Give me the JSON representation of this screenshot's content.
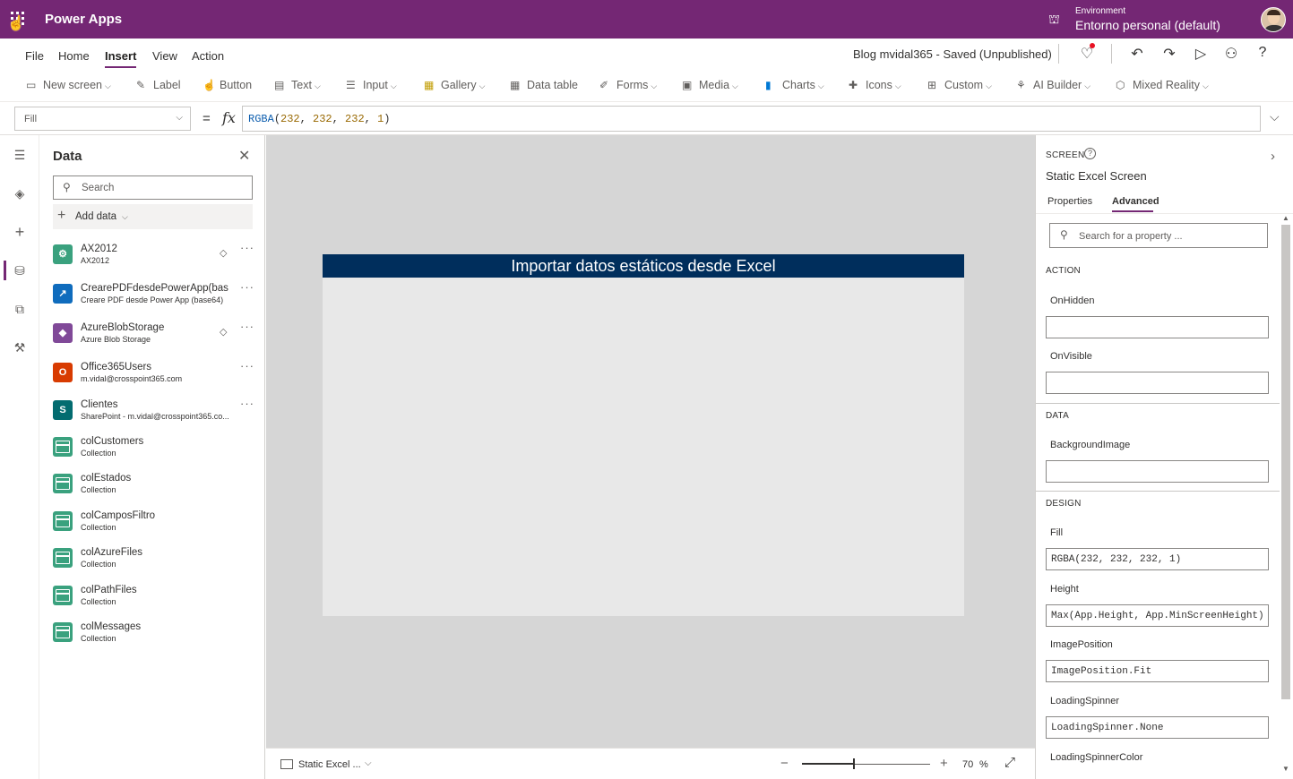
{
  "app": {
    "title": "Power Apps",
    "environment_label": "Environment",
    "environment_value": "Entorno personal (default)"
  },
  "menu": {
    "items": [
      "File",
      "Home",
      "Insert",
      "View",
      "Action"
    ],
    "active": "Insert",
    "doc_status": "Blog mvidal365 - Saved (Unpublished)"
  },
  "ribbon": {
    "new_screen": "New screen",
    "label": "Label",
    "button": "Button",
    "text": "Text",
    "input": "Input",
    "gallery": "Gallery",
    "data_table": "Data table",
    "forms": "Forms",
    "media": "Media",
    "charts": "Charts",
    "icons": "Icons",
    "custom": "Custom",
    "ai_builder": "AI Builder",
    "mixed_reality": "Mixed Reality"
  },
  "formula": {
    "property": "Fill",
    "eq": "=",
    "fx": "fx",
    "fn": "RGBA",
    "args": [
      "232",
      "232",
      "232",
      "1"
    ]
  },
  "data_panel": {
    "title": "Data",
    "search_placeholder": "Search",
    "add_data": "Add data",
    "sources": [
      {
        "name": "AX2012",
        "sub": "AX2012",
        "color": "#3aa17e",
        "glyph": "⚙",
        "premium": true
      },
      {
        "name": "CrearePDFdesdePowerApp(base...",
        "sub": "Creare PDF desde Power App (base64)",
        "color": "#0f6cbd",
        "glyph": "↗",
        "premium": false
      },
      {
        "name": "AzureBlobStorage",
        "sub": "Azure Blob Storage",
        "color": "#804998",
        "glyph": "◆",
        "premium": true
      },
      {
        "name": "Office365Users",
        "sub": "m.vidal@crosspoint365.com",
        "color": "#d83b01",
        "glyph": "O",
        "premium": false
      },
      {
        "name": "Clientes",
        "sub": "SharePoint - m.vidal@crosspoint365.co...",
        "color": "#036c70",
        "glyph": "S",
        "premium": false
      },
      {
        "name": "colCustomers",
        "sub": "Collection",
        "collection": true
      },
      {
        "name": "colEstados",
        "sub": "Collection",
        "collection": true
      },
      {
        "name": "colCamposFiltro",
        "sub": "Collection",
        "collection": true
      },
      {
        "name": "colAzureFiles",
        "sub": "Collection",
        "collection": true
      },
      {
        "name": "colPathFiles",
        "sub": "Collection",
        "collection": true
      },
      {
        "name": "colMessages",
        "sub": "Collection",
        "collection": true
      }
    ]
  },
  "canvas": {
    "screen_header": "Importar datos estáticos desde Excel",
    "header_color": "#002e5c",
    "screen_fill": "#e8e8e8"
  },
  "status_bar": {
    "screen_name": "Static Excel ...",
    "zoom": "70",
    "zoom_unit": "%",
    "zoom_fraction": 0.4
  },
  "properties": {
    "kind": "SCREEN",
    "name": "Static Excel Screen",
    "tabs": [
      "Properties",
      "Advanced"
    ],
    "active_tab": "Advanced",
    "search_placeholder": "Search for a property ...",
    "sections": {
      "action": "ACTION",
      "data": "DATA",
      "design": "DESIGN"
    },
    "on_hidden_label": "OnHidden",
    "on_hidden_value": "",
    "on_visible_label": "OnVisible",
    "on_visible_value": "",
    "background_image_label": "BackgroundImage",
    "background_image_value": "",
    "fill_label": "Fill",
    "fill_value": "RGBA(232, 232, 232, 1)",
    "height_label": "Height",
    "height_value": "Max(App.Height, App.MinScreenHeight)",
    "image_position_label": "ImagePosition",
    "image_position_value": "ImagePosition.Fit",
    "loading_spinner_label": "LoadingSpinner",
    "loading_spinner_value": "LoadingSpinner.None",
    "loading_spinner_color_label": "LoadingSpinnerColor"
  },
  "colors": {
    "brand": "#742774"
  }
}
